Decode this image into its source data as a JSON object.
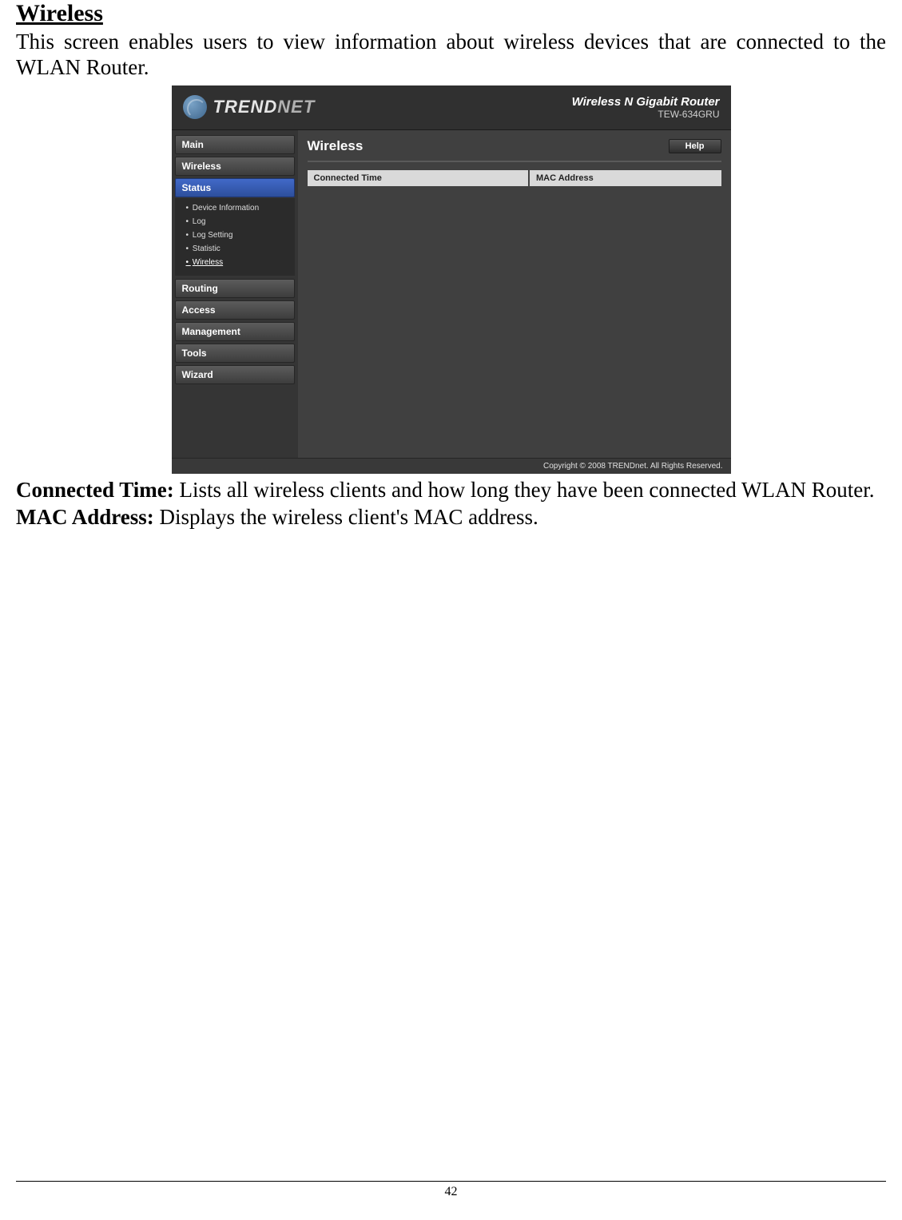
{
  "document": {
    "heading": "Wireless",
    "intro": "This screen enables users to view information about wireless devices that are connected to the WLAN Router.",
    "def1_term": "Connected Time:",
    "def1_text": " Lists all wireless clients and how long they have been connected WLAN Router.",
    "def2_term": "MAC Address:",
    "def2_text": " Displays the wireless client's MAC address.",
    "page_number": "42"
  },
  "router_ui": {
    "brand_a": "TREND",
    "brand_b": "NET",
    "product_line1": "Wireless N Gigabit Router",
    "product_line2": "TEW-634GRU",
    "sidebar": {
      "items": [
        "Main",
        "Wireless",
        "Status",
        "Routing",
        "Access",
        "Management",
        "Tools",
        "Wizard"
      ],
      "status_sub": [
        "Device Information",
        "Log",
        "Log Setting",
        "Statistic",
        "Wireless"
      ]
    },
    "content": {
      "title": "Wireless",
      "help_label": "Help",
      "table_headers": [
        "Connected Time",
        "MAC Address"
      ]
    },
    "footer": "Copyright © 2008 TRENDnet. All Rights Reserved."
  }
}
